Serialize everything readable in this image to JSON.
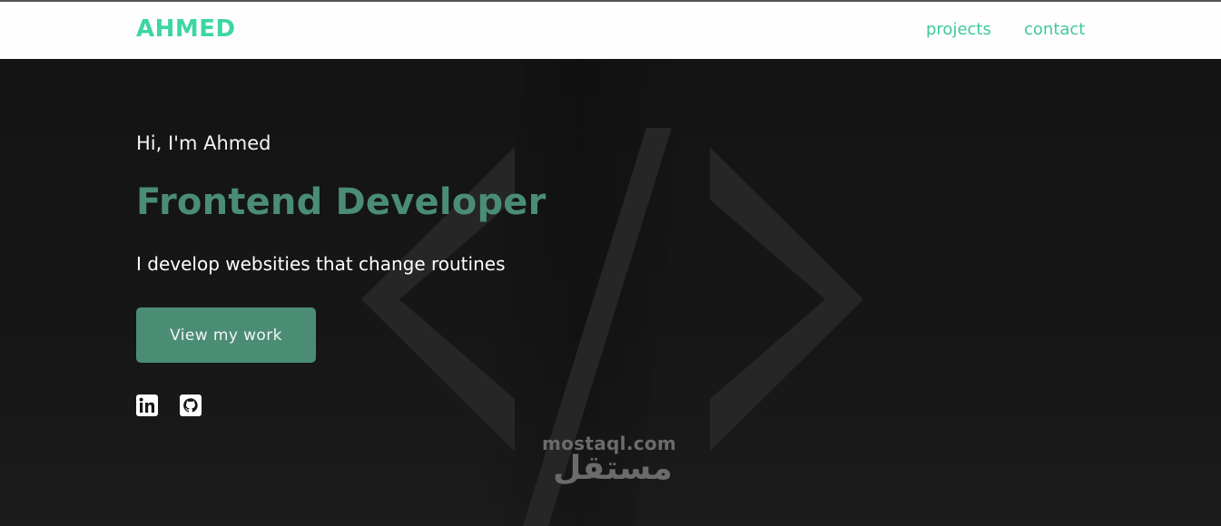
{
  "navbar": {
    "brand": "AHMED",
    "links": [
      {
        "label": "projects"
      },
      {
        "label": "contact"
      }
    ]
  },
  "hero": {
    "greeting": "Hi, I'm Ahmed",
    "role": "Frontend Developer",
    "tagline": "I develop websities that change routines",
    "cta_label": "View my work",
    "social": [
      {
        "icon": "linkedin-icon"
      },
      {
        "icon": "github-icon"
      }
    ],
    "background_icon": "code-brackets-icon"
  },
  "watermark": {
    "text": "mostaql.com",
    "arabic": "مستقل"
  },
  "colors": {
    "accent": "#3dd6a3",
    "accent_dark": "#4a8d74",
    "hero_bg": "#151515",
    "navbar_bg": "#fefefe"
  }
}
